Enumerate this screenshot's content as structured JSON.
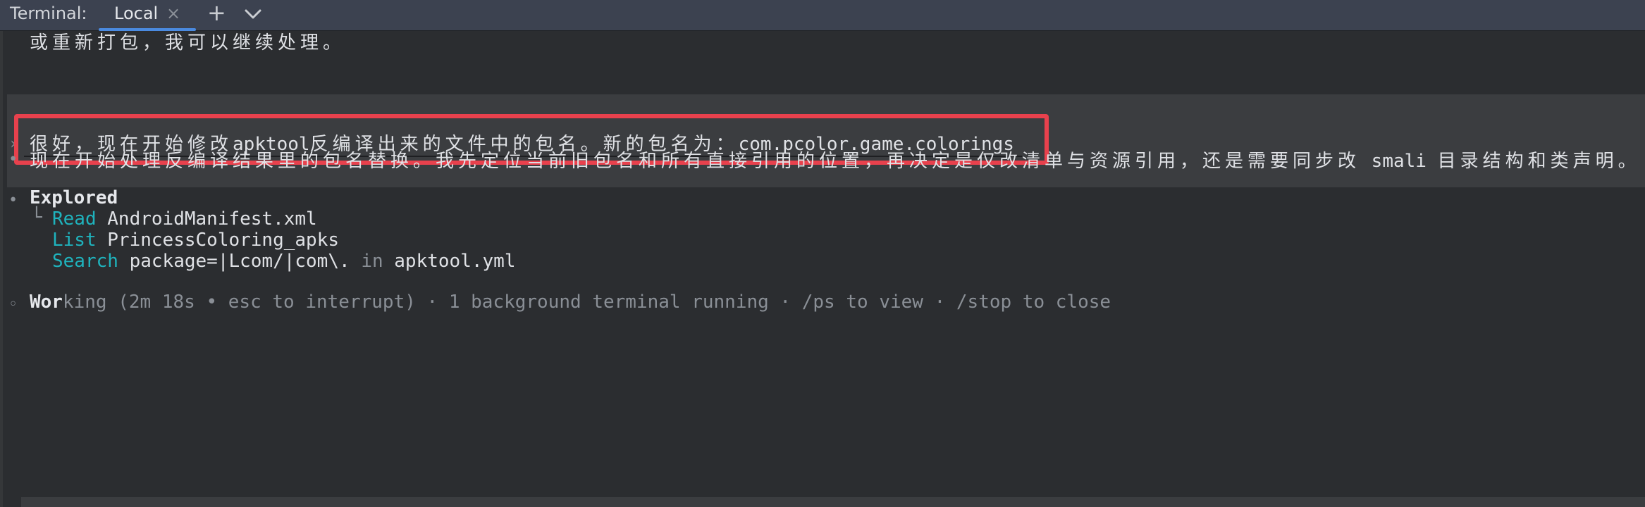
{
  "tabbar": {
    "title": "Terminal:",
    "tab_label": "Local",
    "close_glyph": "×",
    "add_glyph": "+",
    "accent_color": "#4a8ae0"
  },
  "terminal": {
    "line_prev": "或重新打包，我可以继续处理。",
    "prompt_marker": "›",
    "prompt_text_cjk": "很好，现在开始修改",
    "prompt_text_mid1": "apktool",
    "prompt_text_cjk2": "反编译出来的文件中的包名。新的包名为：",
    "prompt_text_pkg": "com.pcolor.game.colorings",
    "highlight_color": "#e8414d",
    "response_bullet": "•",
    "response_cjk1": "现在开始处理反编译结果里的包名替换。我先定位当前旧包名和所有直接引用的位置，再决定是仅改清单与资源引用，还是需要同步改",
    "response_mid": "smali",
    "response_cjk2": "目录结构和类声明。",
    "explored_label": "Explored",
    "tree_glyph": "└",
    "explored_items": [
      {
        "cmd": "Read",
        "arg": "AndroidManifest.xml",
        "kw": "",
        "arg2": ""
      },
      {
        "cmd": "List",
        "arg": "PrincessColoring_apks",
        "kw": "",
        "arg2": ""
      },
      {
        "cmd": "Search",
        "arg": "package=|Lcom/|com\\.",
        "kw": "in",
        "arg2": "apktool.yml"
      }
    ],
    "working_bullet": "◦",
    "working_bold": "Wor",
    "working_rest": "king (2m 18s • esc to interrupt) · 1 background terminal running · /ps to view · /stop to close"
  }
}
